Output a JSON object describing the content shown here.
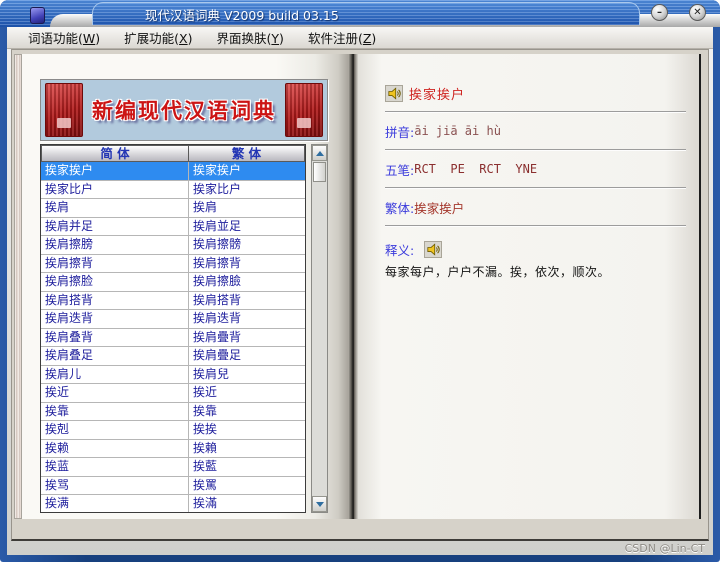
{
  "window": {
    "title": "现代汉语词典 V2009 build 03.15",
    "minimize_glyph": "–",
    "close_glyph": "✕"
  },
  "menu": {
    "items": [
      {
        "pre": "词语功能(",
        "key": "W",
        "post": ")"
      },
      {
        "pre": "扩展功能(",
        "key": "X",
        "post": ")"
      },
      {
        "pre": "界面换肤(",
        "key": "Y",
        "post": ")"
      },
      {
        "pre": "软件注册(",
        "key": "Z",
        "post": ")"
      }
    ]
  },
  "left_page": {
    "banner_title": "新编现代汉语词典",
    "columns": [
      "简  体",
      "繁  体"
    ],
    "rows": [
      {
        "s": "挨家挨户",
        "t": "挨家挨户",
        "selected": true
      },
      {
        "s": "挨家比户",
        "t": "挨家比户",
        "selected": false
      },
      {
        "s": "挨肩",
        "t": "挨肩",
        "selected": false
      },
      {
        "s": "挨肩并足",
        "t": "挨肩並足",
        "selected": false
      },
      {
        "s": "挨肩擦膀",
        "t": "挨肩擦髈",
        "selected": false
      },
      {
        "s": "挨肩擦背",
        "t": "挨肩擦背",
        "selected": false
      },
      {
        "s": "挨肩擦脸",
        "t": "挨肩擦臉",
        "selected": false
      },
      {
        "s": "挨肩搭背",
        "t": "挨肩搭背",
        "selected": false
      },
      {
        "s": "挨肩迭背",
        "t": "挨肩迭背",
        "selected": false
      },
      {
        "s": "挨肩叠背",
        "t": "挨肩疊背",
        "selected": false
      },
      {
        "s": "挨肩叠足",
        "t": "挨肩疊足",
        "selected": false
      },
      {
        "s": "挨肩儿",
        "t": "挨肩兒",
        "selected": false
      },
      {
        "s": "挨近",
        "t": "挨近",
        "selected": false
      },
      {
        "s": "挨靠",
        "t": "挨靠",
        "selected": false
      },
      {
        "s": "挨剋",
        "t": "挨挨",
        "selected": false
      },
      {
        "s": "挨赖",
        "t": "挨賴",
        "selected": false
      },
      {
        "s": "挨蓝",
        "t": "挨藍",
        "selected": false
      },
      {
        "s": "挨骂",
        "t": "挨罵",
        "selected": false
      },
      {
        "s": "挨满",
        "t": "挨滿",
        "selected": false
      }
    ]
  },
  "right_page": {
    "headword": "挨家挨户",
    "pinyin_label": "拼音:",
    "pinyin": "āi jiā āi hù",
    "wubi_label": "五笔:",
    "wubi": "RCT  PE  RCT  YNE",
    "trad_label": "繁体:",
    "trad": "挨家挨户",
    "def_label": "释义:",
    "definition": "每家每户，户户不漏。挨，依次，顺次。"
  },
  "watermark": "CSDN @Lin-CT",
  "colors": {
    "titlebar_blue": "#2058b4",
    "selected_row": "#2e8bf0",
    "headword_red": "#cf2420",
    "label_blue": "#3b3bdc",
    "cell_navy": "#1d1d9c"
  }
}
